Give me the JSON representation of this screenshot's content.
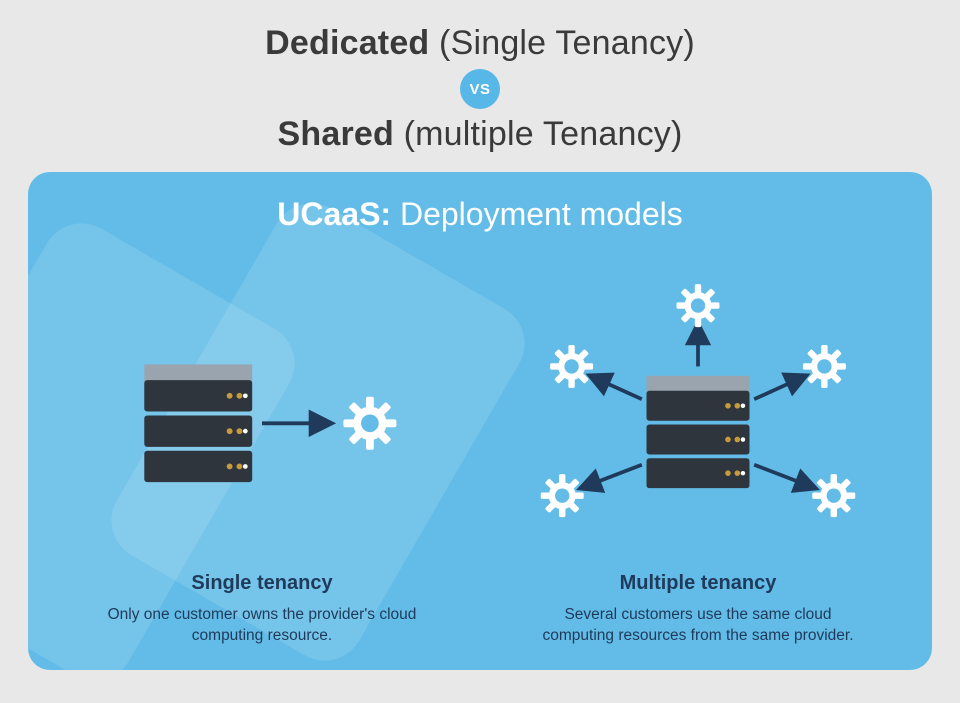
{
  "header": {
    "line1_bold": "Dedicated",
    "line1_rest": " (Single Tenancy)",
    "vs_label": "VS",
    "line2_bold": "Shared",
    "line2_rest": " (multiple Tenancy)"
  },
  "card": {
    "title_bold": "UCaaS:",
    "title_rest": " Deployment models"
  },
  "models": {
    "single": {
      "name": "Single tenancy",
      "desc": "Only one customer owns the provider's cloud computing resource."
    },
    "multiple": {
      "name": "Multiple tenancy",
      "desc": "Several customers use the same cloud computing resources from the same provider."
    }
  },
  "colors": {
    "accent": "#62bce7",
    "badge": "#57b7e6",
    "dark": "#2b2f36",
    "cardText": "#1f3a5a"
  }
}
